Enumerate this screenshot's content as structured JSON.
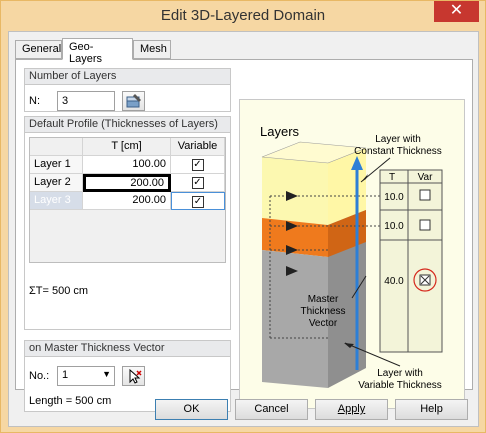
{
  "window": {
    "title": "Edit 3D-Layered Domain",
    "close_glyph": "✕"
  },
  "tabs": [
    {
      "label": "General"
    },
    {
      "label": "Geo-Layers"
    },
    {
      "label": "Mesh"
    }
  ],
  "number_of_layers": {
    "header": "Number of Layers",
    "n_label": "N:",
    "n_value": "3"
  },
  "default_profile": {
    "header": "Default Profile (Thicknesses of Layers)",
    "columns": [
      "T [cm]",
      "Variable"
    ],
    "rows": [
      {
        "name": "Layer 1",
        "t": "100.00",
        "variable": true
      },
      {
        "name": "Layer 2",
        "t": "200.00",
        "variable": true
      },
      {
        "name": "Layer 3",
        "t": "200.00",
        "variable": true
      }
    ],
    "sum": "ΣT= 500 cm"
  },
  "master_vector": {
    "header": "on Master Thickness Vector",
    "no_label": "No.:",
    "no_value": "1",
    "length": "Length = 500 cm"
  },
  "illustration": {
    "title": "Layers",
    "label_constant_1": "Layer with",
    "label_constant_2": "Constant Thickness",
    "label_master_1": "Master",
    "label_master_2": "Thickness",
    "label_master_3": "Vector",
    "label_variable_1": "Layer with",
    "label_variable_2": "Variable Thickness",
    "col_t": "T",
    "col_var": "Var",
    "values": [
      "10.0",
      "10.0",
      "40.0"
    ]
  },
  "buttons": {
    "ok": "OK",
    "cancel": "Cancel",
    "apply": "Apply",
    "help": "Help"
  }
}
